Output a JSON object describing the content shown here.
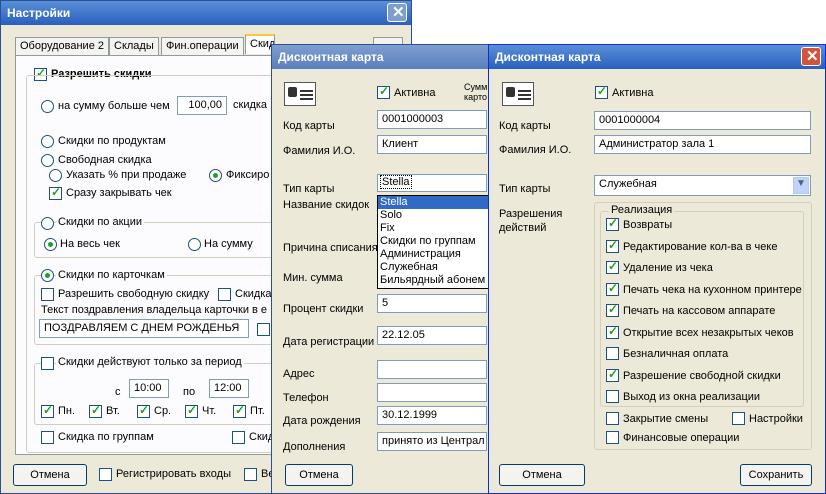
{
  "settings": {
    "title": "Настройки",
    "tabs": [
      "Оборудование 2",
      "Склады",
      "Фин.операции",
      "Скид"
    ],
    "allow_discounts": "Разрешить скидки",
    "sum_over": "на сумму больше чем",
    "sum_value": "100,00",
    "sum_suffix": "скидка",
    "by_products": "Скидки по продуктам",
    "free_discount": "Свободная скидка",
    "percent_on_sale": "Указать % при продаже",
    "fixed": "Фиксиро",
    "close_check": "Сразу закрывать чек",
    "by_promo": "Скидки по акции",
    "whole_check": "На весь чек",
    "on_sum": "На сумму",
    "by_cards": "Скидки по карточкам",
    "allow_free": "Разрешить свободную скидку",
    "card_cut": "Скидка",
    "greeting_label": "Текст поздравления владельца карточки в е",
    "greeting_value": "ПОЗДРАВЛЯЕМ С ДНЕМ РОЖДЕНЬЯ",
    "period": "Скидки действуют только за период",
    "from_label": "с",
    "from_value": "10:00",
    "to_label": "по",
    "to_value": "12:00",
    "days": [
      "Пн.",
      "Вт.",
      "Ср.",
      "Чт.",
      "Пт."
    ],
    "by_groups": "Скидка по группам",
    "cut_right": "Скид",
    "cancel": "Отмена",
    "register_entries": "Регистрировать входы",
    "cut_bottom": "Ве"
  },
  "card1": {
    "title": "Дисконтная карта",
    "active": "Активна",
    "sum_cut1": "Сумм",
    "sum_cut2": "карто",
    "code_label": "Код карты",
    "code_value": "0001000003",
    "name_label": "Фамилия И.О.",
    "name_value": "Клиент",
    "type_label": "Тип карты",
    "type_value": "Stella",
    "discount_name_label": "Название скидок",
    "options": [
      "Stella",
      "Solo",
      "Fix",
      "Скидки по группам",
      "Администрация",
      "Служебная",
      "Бильярдный абонем"
    ],
    "reason_label": "Причина списания",
    "minsum_label": "Мин. сумма",
    "percent_label": "Процент скидки",
    "percent_value": "5",
    "regdate_label": "Дата регистрации",
    "regdate_value": "22.12.05",
    "address_label": "Адрес",
    "phone_label": "Телефон",
    "birth_label": "Дата рождения",
    "birth_value": "30.12.1999",
    "extra_label": "Дополнения",
    "extra_value": "принято из Централ",
    "cancel": "Отмена"
  },
  "card2": {
    "title": "Дисконтная карта",
    "active": "Активна",
    "code_label": "Код карты",
    "code_value": "0001000004",
    "name_label": "Фамилия И.О.",
    "name_value": "Администратор зала 1",
    "type_label": "Тип карты",
    "type_value": "Служебная",
    "perm_label1": "Разрешения",
    "perm_label2": "действий",
    "group_title": "Реализация",
    "perms": [
      {
        "label": "Возвраты",
        "checked": true
      },
      {
        "label": "Редактирование кол-ва в чеке",
        "checked": true
      },
      {
        "label": "Удаление из чека",
        "checked": true
      },
      {
        "label": "Печать чека на кухонном принтере",
        "checked": true
      },
      {
        "label": "Печать на кассовом аппарате",
        "checked": true
      },
      {
        "label": "Открытие всех незакрытых чеков",
        "checked": true
      },
      {
        "label": "Безналичная оплата",
        "checked": false
      },
      {
        "label": "Разрешение свободной скидки",
        "checked": true
      },
      {
        "label": "Выход из окна реализации",
        "checked": false
      }
    ],
    "close_shift": "Закрытие смены",
    "settings": "Настройки",
    "fin_ops": "Финансовые операции",
    "cancel": "Отмена",
    "save": "Сохранить"
  }
}
